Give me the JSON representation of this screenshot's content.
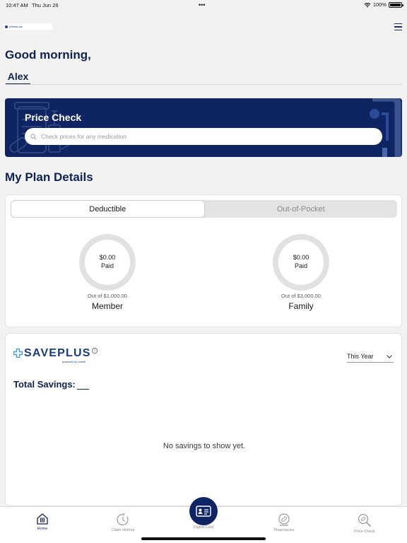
{
  "status_bar": {
    "time": "10:47 AM",
    "date": "Thu Jun 26",
    "dots": "•••",
    "battery": "100%"
  },
  "header": {
    "logo_text": "CAPITAL RX"
  },
  "greeting": "Good morning,",
  "profile": {
    "name": "Alex"
  },
  "price_check": {
    "title": "Price Check",
    "search_placeholder": "Check prices for any medication",
    "background_color": "#0f2563"
  },
  "plan": {
    "title": "My Plan Details",
    "tabs": [
      {
        "label": "Deductible",
        "active": true
      },
      {
        "label": "Out-of-Pocket",
        "active": false
      }
    ],
    "gauges": [
      {
        "amount": "$0.00",
        "status": "Paid",
        "out_of": "Out of $1,000.00",
        "who": "Member",
        "fraction": 0
      },
      {
        "amount": "$0.00",
        "status": "Paid",
        "out_of": "Out of $3,000.00",
        "who": "Family",
        "fraction": 0
      }
    ]
  },
  "savings": {
    "brand": "SAVEPLUS",
    "info_icon": "i",
    "powered_by": "powered by Liviniti",
    "period": "This Year",
    "total_label": "Total Savings:",
    "total_value": "",
    "empty_message": "No savings to show yet."
  },
  "tab_bar": {
    "tabs": [
      {
        "label": "Home",
        "icon": "home-icon",
        "active": true
      },
      {
        "label": "Claim History",
        "icon": "clock-history-icon",
        "active": false
      },
      {
        "label": "Digital Card",
        "icon": "id-card-icon",
        "active": false
      },
      {
        "label": "Pharmacies",
        "icon": "pharmacy-icon",
        "active": false
      },
      {
        "label": "Price Check",
        "icon": "price-search-icon",
        "active": false
      }
    ],
    "accent_color": "#0f2250"
  }
}
